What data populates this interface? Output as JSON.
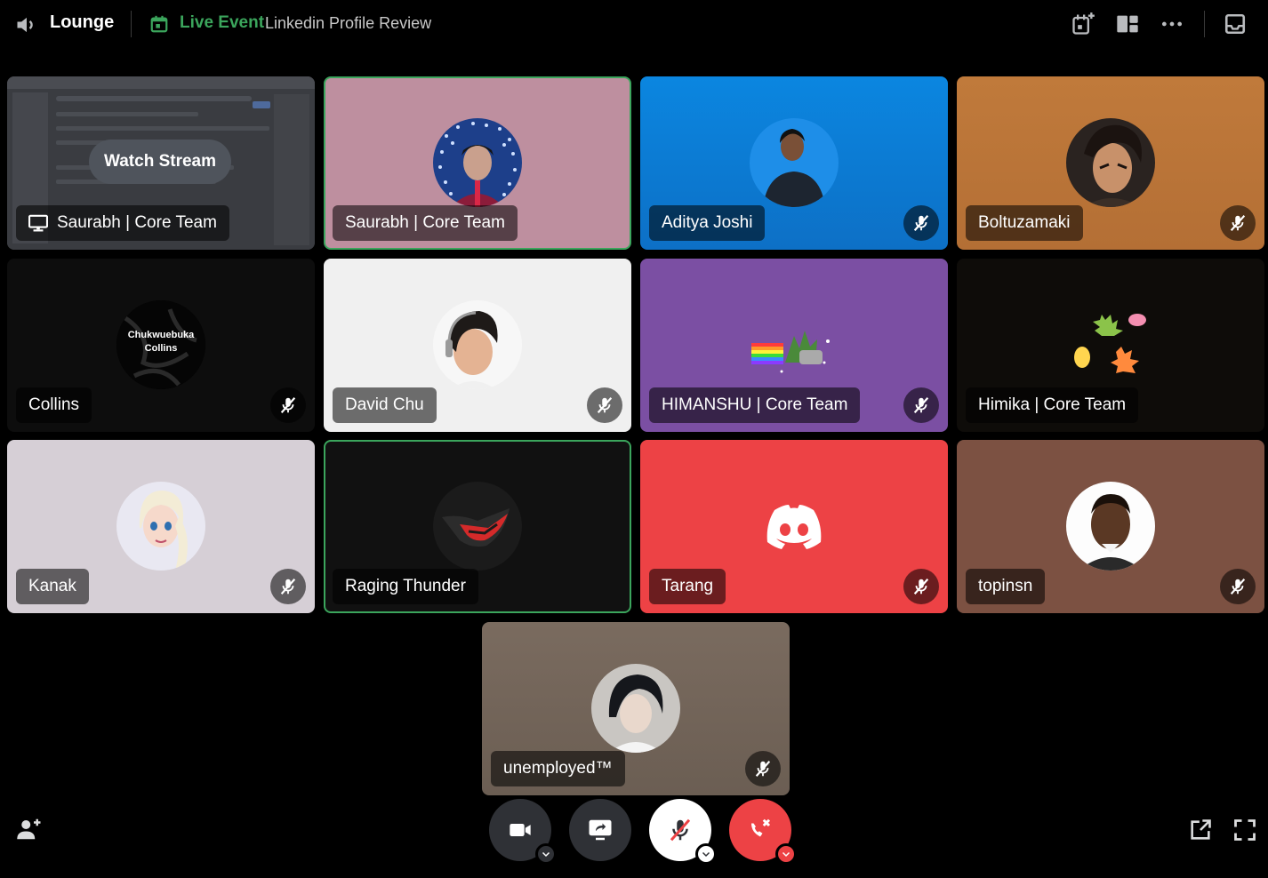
{
  "header": {
    "channel_name": "Lounge",
    "live_label": "Live Event",
    "event_name": "Linkedin Profile Review"
  },
  "stream": {
    "watch_label": "Watch Stream",
    "streamer_name": "Saurabh | Core Team"
  },
  "participants": [
    {
      "name": "Saurabh | Core Team",
      "speaking": true,
      "muted": false,
      "tile_color": "#be8f9f"
    },
    {
      "name": "Aditya Joshi",
      "speaking": false,
      "muted": true,
      "tile_color": "#0a7fd8"
    },
    {
      "name": "Boltuzamaki",
      "speaking": false,
      "muted": true,
      "tile_color": "#b8763b"
    },
    {
      "name": "Collins",
      "speaking": false,
      "muted": true,
      "tile_color": "#0d0d0d",
      "avatar_text": "Chukwuebuka Collins"
    },
    {
      "name": "David Chu",
      "speaking": false,
      "muted": true,
      "tile_color": "#f0f0f0"
    },
    {
      "name": "HIMANSHU | Core Team",
      "speaking": false,
      "muted": true,
      "tile_color": "#7b4fa3"
    },
    {
      "name": "Himika | Core Team",
      "speaking": false,
      "muted": false,
      "tile_color": "#0e0c09"
    },
    {
      "name": "Kanak",
      "speaking": false,
      "muted": true,
      "tile_color": "#d6cfd6"
    },
    {
      "name": "Raging Thunder",
      "speaking": true,
      "muted": false,
      "tile_color": "#111111"
    },
    {
      "name": "Tarang",
      "speaking": false,
      "muted": true,
      "tile_color": "#ed4245"
    },
    {
      "name": "topinsn",
      "speaking": false,
      "muted": true,
      "tile_color": "#7c5142"
    },
    {
      "name": "unemployed™",
      "speaking": false,
      "muted": true,
      "tile_color": "#75685d"
    }
  ],
  "controls": {
    "camera_icon": "video-camera-icon",
    "share_icon": "screen-share-icon",
    "mic_icon": "microphone-off-icon",
    "leave_icon": "phone-hangup-icon"
  },
  "colors": {
    "speaking": "#3ba55c",
    "live": "#3ba55c",
    "danger": "#ed4245"
  }
}
